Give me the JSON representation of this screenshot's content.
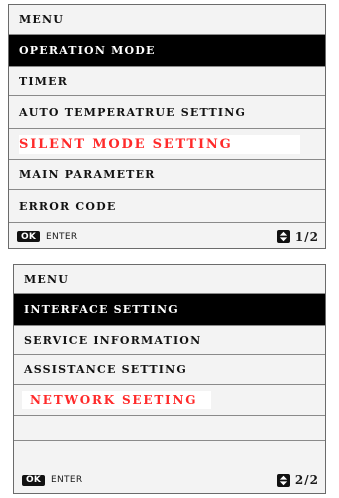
{
  "screens": [
    {
      "header": "MENU",
      "items": [
        {
          "label": "OPERATION MODE",
          "state": "selected"
        },
        {
          "label": "TIMER",
          "state": "normal"
        },
        {
          "label": "AUTO TEMPERATRUE SETTING",
          "state": "normal"
        },
        {
          "label": "SILENT MODE SETTING",
          "state": "highlight"
        },
        {
          "label": "MAIN PARAMETER",
          "state": "normal"
        },
        {
          "label": "ERROR CODE",
          "state": "normal"
        }
      ],
      "footer": {
        "ok_label": "OK",
        "enter_label": "ENTER",
        "page": "1/2",
        "page_icon": "up-down-arrows-icon"
      }
    },
    {
      "header": "MENU",
      "items": [
        {
          "label": "INTERFACE SETTING",
          "state": "selected"
        },
        {
          "label": "SERVICE INFORMATION",
          "state": "normal"
        },
        {
          "label": "ASSISTANCE SETTING",
          "state": "normal"
        },
        {
          "label": "NETWORK SEETING",
          "state": "highlight"
        },
        {
          "label": "",
          "state": "empty"
        },
        {
          "label": "",
          "state": "empty"
        }
      ],
      "footer": {
        "ok_label": "OK",
        "enter_label": "ENTER",
        "page": "2/2",
        "page_icon": "up-down-arrows-icon"
      }
    }
  ],
  "colors": {
    "selected_background": "#000000",
    "selected_text": "#ffffff",
    "highlight_text": "#ff2a2a",
    "screen_background": "#f3f3f3"
  }
}
